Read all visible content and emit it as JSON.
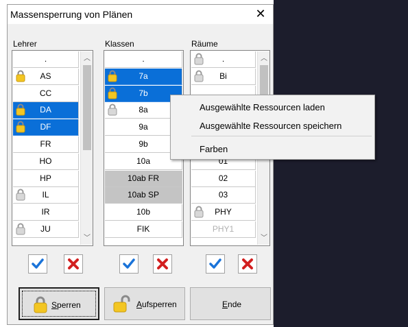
{
  "dialog": {
    "title": "Massensperrung von Plänen",
    "close_glyph": "✕"
  },
  "columns": {
    "lehrer": {
      "label": "Lehrer",
      "rows": [
        {
          "text": ".",
          "lock": "",
          "state": "normal"
        },
        {
          "text": "AS",
          "lock": "gold",
          "state": "normal"
        },
        {
          "text": "CC",
          "lock": "",
          "state": "normal"
        },
        {
          "text": "DA",
          "lock": "gold",
          "state": "selected"
        },
        {
          "text": "DF",
          "lock": "gold",
          "state": "selected"
        },
        {
          "text": "FR",
          "lock": "",
          "state": "normal"
        },
        {
          "text": "HO",
          "lock": "",
          "state": "normal"
        },
        {
          "text": "HP",
          "lock": "",
          "state": "normal"
        },
        {
          "text": "IL",
          "lock": "gray",
          "state": "normal"
        },
        {
          "text": "IR",
          "lock": "",
          "state": "normal"
        },
        {
          "text": "JU",
          "lock": "gray",
          "state": "normal"
        }
      ]
    },
    "klassen": {
      "label": "Klassen",
      "rows": [
        {
          "text": ".",
          "lock": "",
          "state": "normal"
        },
        {
          "text": "7a",
          "lock": "gold",
          "state": "selected"
        },
        {
          "text": "7b",
          "lock": "gold",
          "state": "selected"
        },
        {
          "text": "8a",
          "lock": "gray",
          "state": "normal"
        },
        {
          "text": "9a",
          "lock": "",
          "state": "normal"
        },
        {
          "text": "9b",
          "lock": "",
          "state": "normal"
        },
        {
          "text": "10a",
          "lock": "",
          "state": "normal"
        },
        {
          "text": "10ab FR",
          "lock": "",
          "state": "gray"
        },
        {
          "text": "10ab SP",
          "lock": "",
          "state": "gray"
        },
        {
          "text": "10b",
          "lock": "",
          "state": "normal"
        },
        {
          "text": "FIK",
          "lock": "",
          "state": "normal"
        }
      ]
    },
    "raeume": {
      "label": "Räume",
      "rows": [
        {
          "text": ".",
          "lock": "gray",
          "state": "normal"
        },
        {
          "text": "Bi",
          "lock": "gray",
          "state": "normal"
        },
        {
          "text": "",
          "lock": "",
          "state": "normal"
        },
        {
          "text": "",
          "lock": "",
          "state": "normal"
        },
        {
          "text": "",
          "lock": "",
          "state": "normal"
        },
        {
          "text": "",
          "lock": "",
          "state": "normal"
        },
        {
          "text": "01",
          "lock": "",
          "state": "normal"
        },
        {
          "text": "02",
          "lock": "",
          "state": "normal"
        },
        {
          "text": "03",
          "lock": "",
          "state": "normal"
        },
        {
          "text": "PHY",
          "lock": "gray",
          "state": "normal"
        },
        {
          "text": "PHY1",
          "lock": "",
          "state": "disabled"
        }
      ]
    }
  },
  "buttons": {
    "sperren": {
      "accel": "S",
      "rest": "perren"
    },
    "aufsperren": {
      "accel": "A",
      "rest": "ufsperren"
    },
    "ende": {
      "accel": "E",
      "rest": "nde"
    }
  },
  "context_menu": {
    "items": [
      "Ausgewählte Ressourcen laden",
      "Ausgewählte Ressourcen speichern",
      "Farben"
    ]
  },
  "colors": {
    "selection": "#0a6fd8",
    "check_blue": "#1a73d9",
    "cross_red": "#d21f1f",
    "lock_gold": "#f3c623"
  }
}
